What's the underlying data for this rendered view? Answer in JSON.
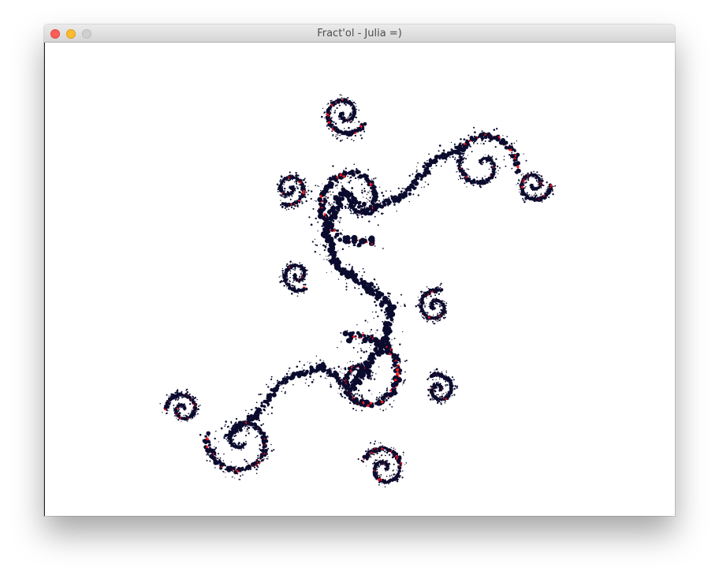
{
  "window": {
    "title": "Fract'ol - Julia =)"
  },
  "colors": {
    "fractal_body": "#0b0b2e",
    "fractal_accent": "#ff1a1a",
    "background": "#ffffff",
    "close_button": "#fc5f57",
    "minimize_button": "#fdbc2e",
    "zoom_button": "#d0d0d0"
  }
}
